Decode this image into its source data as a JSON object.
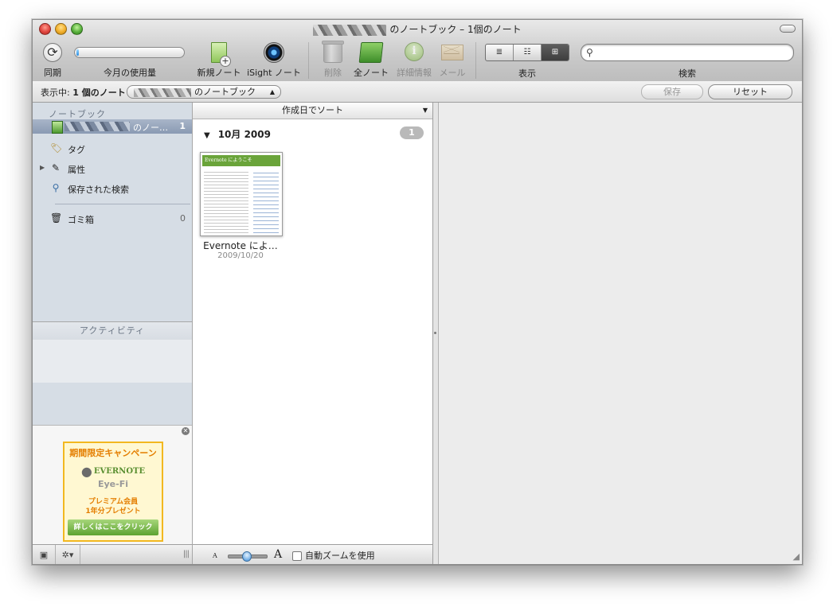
{
  "window": {
    "title_suffix": "のノートブック – 1個のノート"
  },
  "toolbar": {
    "sync_label": "同期",
    "usage_label": "今月の使用量",
    "usage_fraction": 0.02,
    "new_note_label": "新規ノート",
    "isight_label": "iSight ノート",
    "delete_label": "削除",
    "all_notes_label": "全ノート",
    "info_label": "詳細情報",
    "mail_label": "メール",
    "view_label": "表示",
    "view_modes": [
      "≣",
      "☷",
      "⊞"
    ],
    "search_label": "検索",
    "search_value": ""
  },
  "filterbar": {
    "showing_prefix": "表示中:",
    "showing_count": "1 個のノート",
    "notebook_select": "のノートブック",
    "save_button": "保存",
    "reset_button": "リセット"
  },
  "sidebar": {
    "notebooks_header": "ノートブック",
    "notebook_name": "のノー…",
    "notebook_count": "1",
    "tags": "タグ",
    "attributes": "属性",
    "saved_searches": "保存された検索",
    "trash": "ゴミ箱",
    "trash_count": "0",
    "activity_header": "アクティビティ"
  },
  "ad": {
    "title": "期間限定キャンペーン",
    "evernote_logo": "EVERNOTE",
    "eyefi_logo": "Eye-Fi",
    "line1": "プレミアム会員",
    "line2": "1年分プレゼント",
    "cta": "詳しくはここをクリック"
  },
  "notelist": {
    "sort_label": "作成日でソート",
    "group_label": "10月 2009",
    "group_count": "1",
    "thumb_banner": "Evernote にようこそ",
    "note_title": "Evernote によ…",
    "note_date": "2009/10/20"
  },
  "zoom": {
    "small_a": "A",
    "large_a": "A",
    "level": 0.45,
    "auto_zoom_label": "自動ズームを使用"
  }
}
